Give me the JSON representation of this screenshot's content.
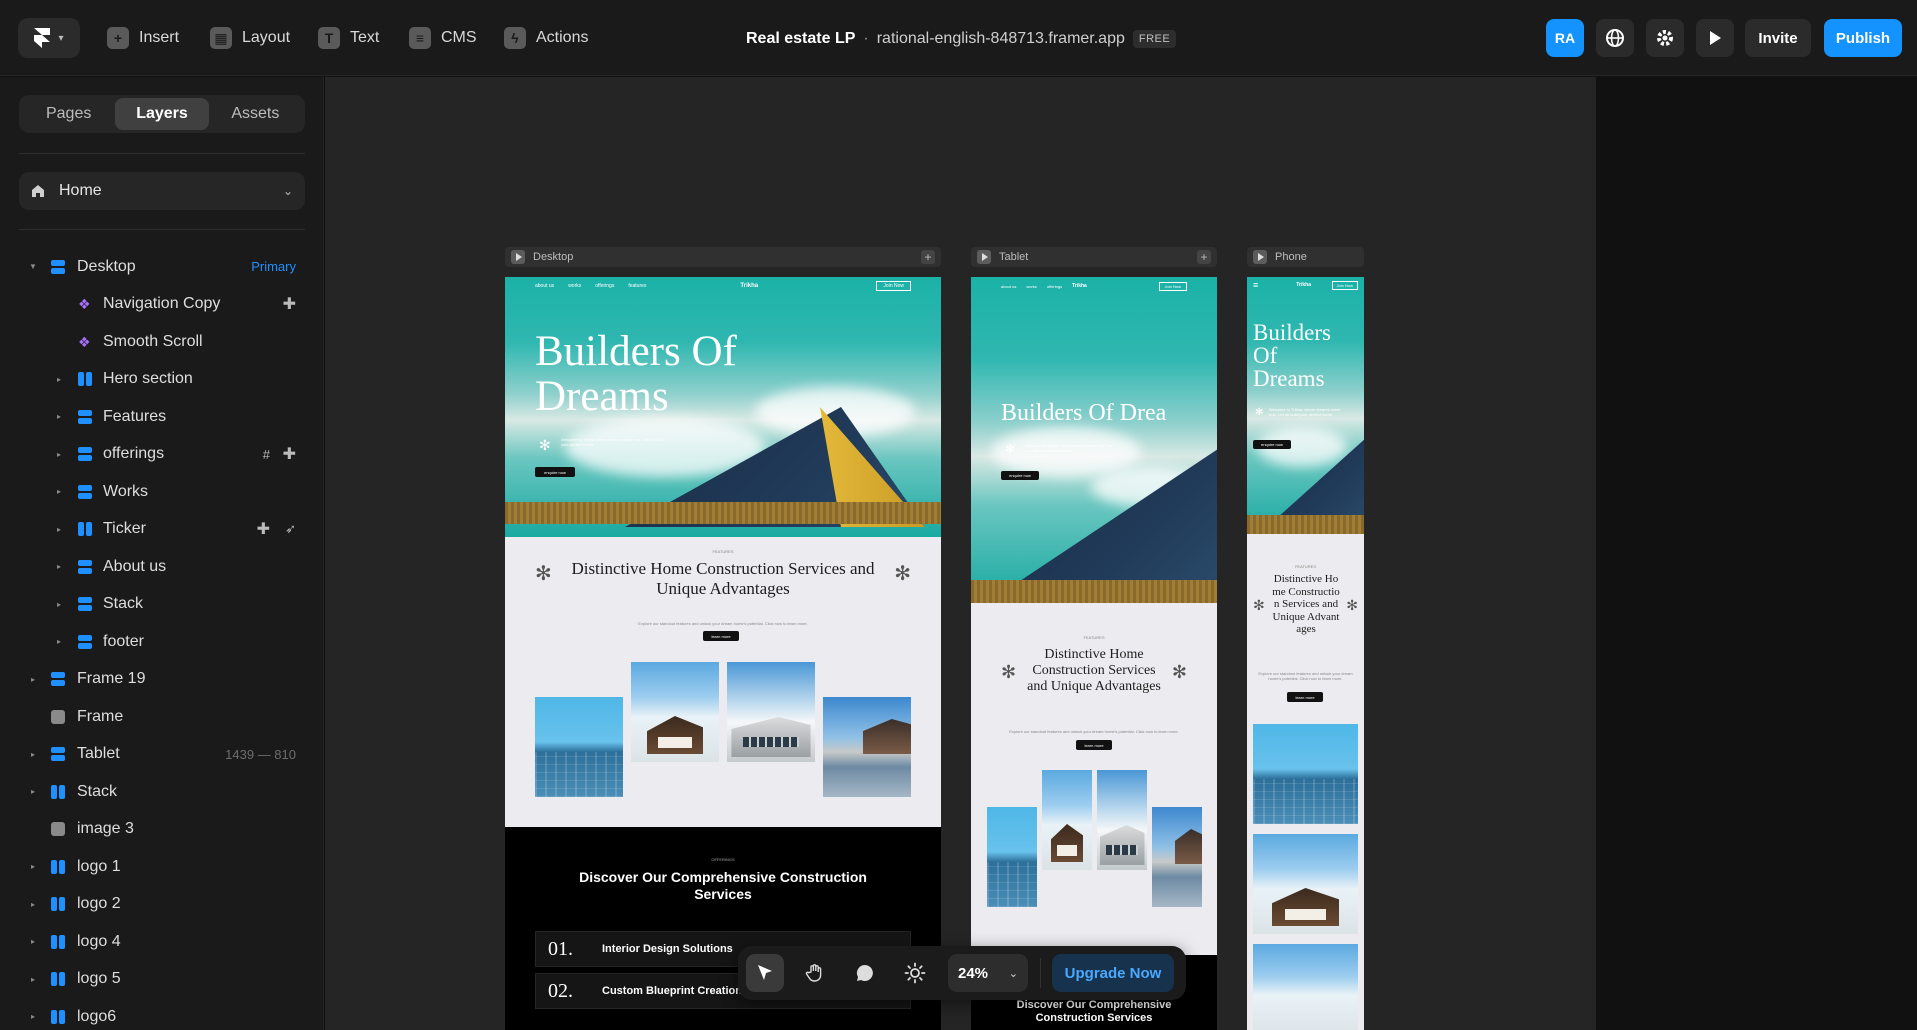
{
  "topbar": {
    "tools": [
      {
        "label": "Insert",
        "icon": "plus-icon"
      },
      {
        "label": "Layout",
        "icon": "layout-icon"
      },
      {
        "label": "Text",
        "icon": "text-icon"
      },
      {
        "label": "CMS",
        "icon": "database-icon"
      },
      {
        "label": "Actions",
        "icon": "bolt-icon"
      }
    ],
    "project_name": "Real estate LP",
    "separator": "·",
    "project_url": "rational-english-848713.framer.app",
    "plan_badge": "FREE",
    "avatar_initials": "RA",
    "invite_label": "Invite",
    "publish_label": "Publish",
    "accent_color": "#1493ff"
  },
  "sidebar": {
    "tabs": [
      {
        "label": "Pages",
        "active": false
      },
      {
        "label": "Layers",
        "active": true
      },
      {
        "label": "Assets",
        "active": false
      }
    ],
    "current_page": "Home",
    "layers": [
      {
        "label": "Desktop",
        "icon": "stack",
        "badge": "Primary"
      },
      {
        "label": "Navigation Copy",
        "icon": "component"
      },
      {
        "label": "Smooth Scroll",
        "icon": "component"
      },
      {
        "label": "Hero section",
        "icon": "hstack"
      },
      {
        "label": "Features",
        "icon": "stack"
      },
      {
        "label": "offerings",
        "icon": "stack"
      },
      {
        "label": "Works",
        "icon": "stack"
      },
      {
        "label": "Ticker",
        "icon": "hstack"
      },
      {
        "label": "About us",
        "icon": "stack"
      },
      {
        "label": "Stack",
        "icon": "stack"
      },
      {
        "label": "footer",
        "icon": "stack"
      },
      {
        "label": "Frame 19",
        "icon": "stack"
      },
      {
        "label": "Frame",
        "icon": "frame"
      },
      {
        "label": "Tablet",
        "icon": "stack",
        "dims": "1439 — 810"
      },
      {
        "label": "Stack",
        "icon": "hstack"
      },
      {
        "label": "image 3",
        "icon": "frame"
      },
      {
        "label": "logo 1",
        "icon": "hstack"
      },
      {
        "label": "logo 2",
        "icon": "hstack"
      },
      {
        "label": "logo 4",
        "icon": "hstack"
      },
      {
        "label": "logo 5",
        "icon": "hstack"
      },
      {
        "label": "logo6",
        "icon": "hstack"
      }
    ]
  },
  "canvas": {
    "frames": {
      "desktop": "Desktop",
      "tablet": "Tablet",
      "phone": "Phone"
    },
    "site": {
      "nav_items": [
        "about us",
        "works",
        "offerings",
        "features"
      ],
      "nav_logo": "Trikha",
      "nav_cta": "Join Now",
      "hero_title_desktop": "Builders Of Dreams",
      "hero_title_tablet": "Builders Of Drea",
      "hero_sub": "Welcome to Trikha, where dreams come true. Let us build your perfect home.",
      "hero_btn": "enquire now",
      "features_small": "FEATURES",
      "features_title": "Distinctive Home Construction Services and Unique Advantages",
      "features_desc": "Explore our standout features and unlock your dream home's potential. Click now to learn more.",
      "features_btn": "learn more",
      "offer_small": "OFFERINGS",
      "offer_title": "Discover Our Comprehensive Construction Services",
      "offer_rows": [
        {
          "num": "01.",
          "label": "Interior Design Solutions"
        },
        {
          "num": "02.",
          "label": "Custom Blueprint Creation"
        }
      ]
    }
  },
  "floatbar": {
    "zoom": "24%",
    "upgrade_label": "Upgrade Now"
  }
}
